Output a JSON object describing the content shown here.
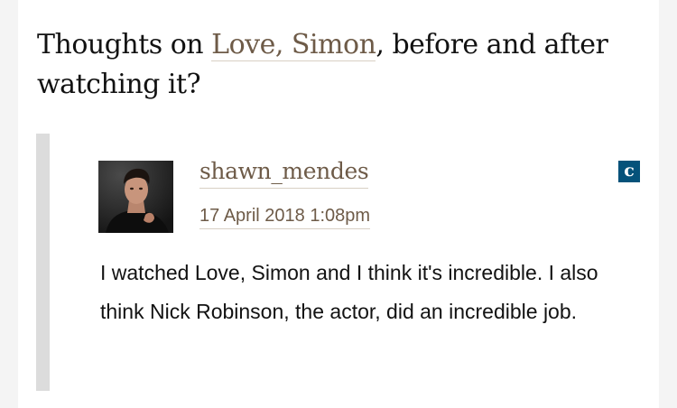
{
  "question": {
    "prefix": "Thoughts on ",
    "title_link": "Love, Simon",
    "suffix": ", before and after watching it?"
  },
  "comment": {
    "avatar_icon": "profile-photo",
    "username": "shawn_mendes",
    "timestamp": "17 April 2018 1:08pm",
    "badge": "c",
    "body": "I watched Love, Simon and I think it's incredible. I also think Nick Robinson, the actor, did an incredible job."
  },
  "colors": {
    "link": "#6e5b48",
    "badge_bg": "#05527a",
    "text": "#121212",
    "quote_bar": "#dcdcdc"
  }
}
